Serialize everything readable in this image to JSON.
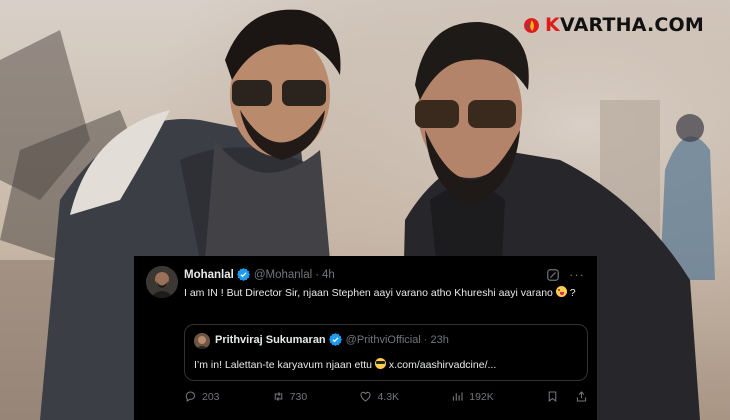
{
  "brand": {
    "k_letter": "K",
    "rest": "VARTHA.COM",
    "logo_icon": "kvartha-flame-icon"
  },
  "tweet": {
    "author_name": "Mohanlal",
    "handle": "@Mohanlal",
    "separator": "·",
    "time": "4h",
    "more_label": "···",
    "text_before_emoji": "I am IN ! But Director Sir, njaan Stephen aayi varano atho Khureshi aayi varano",
    "text_after_emoji": " ?",
    "quote": {
      "author_name": "Prithviraj Sukumaran",
      "handle": "@PrithviOfficial",
      "separator": "·",
      "time": "23h",
      "text_before_emoji": "I’m in! Lalettan-te karyavum njaan ettu ",
      "link": " x.com/aashirvadcine/..."
    },
    "stats": {
      "replies": "203",
      "reposts": "730",
      "likes": "4.3K",
      "views": "192K"
    }
  },
  "colors": {
    "tweet_bg": "#000000",
    "verified": "#1d9bf0",
    "muted": "#71767b",
    "brand_red": "#e01b1b"
  }
}
